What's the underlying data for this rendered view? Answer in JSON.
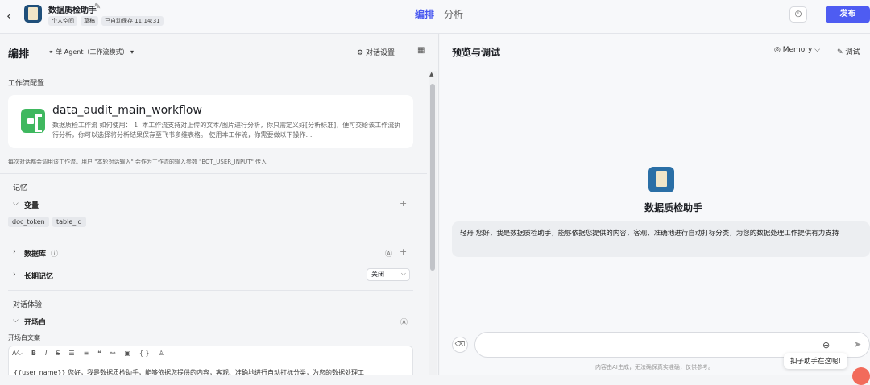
{
  "topbar": {
    "app_name": "数据质检助手",
    "meta": [
      "个人空间",
      "草稿",
      "已自动保存 11:14:31"
    ],
    "tabs": [
      {
        "label": "编排"
      },
      {
        "label": "分析"
      }
    ],
    "publish_label": "发布"
  },
  "left": {
    "title": "编排",
    "agent_mode": "单 Agent（工作流模式）",
    "dialog_settings": "对话设置",
    "workflow_section": "工作流配置",
    "workflow": {
      "name": "data_audit_main_workflow",
      "description": "数据质检工作流 如何使用： 1. 本工作流支持对上传的文本/图片进行分析，你只需定义好[分析标准]，便可交给该工作流执行分析，你可以选择将分析结果保存至飞书多维表格。 使用本工作流，你需要做以下操作…"
    },
    "workflow_hint": "每次对话都会调用该工作流。用户 \"本轮对话输入\" 会作为工作流的输入参数 \"BOT_USER_INPUT\" 传入",
    "memory_section": "记忆",
    "variables_label": "变量",
    "variables": [
      "doc_token",
      "table_id"
    ],
    "database_label": "数据库",
    "long_memory_label": "长期记忆",
    "long_memory_value": "关闭",
    "dialog_section": "对话体验",
    "opening_label": "开场白",
    "opening_text_label": "开场白文案",
    "editor_text": "{{user_name}} 您好，我是数据质检助手，能够依据您提供的内容，客观、准确地进行自动打标分类，为您的数据处理工"
  },
  "right": {
    "title": "预览与调试",
    "memory_label": "Memory",
    "debug_label": "调试",
    "bot_name": "数据质检助手",
    "greeting": "轻舟 您好，我是数据质检助手，能够依据您提供的内容，客观、准确地进行自动打标分类，为您的数据处理工作提供有力支持",
    "disclaimer": "内容由AI生成，无法确保真实准确，仅供参考。",
    "helper_text": "扣子助手在这呢!"
  }
}
